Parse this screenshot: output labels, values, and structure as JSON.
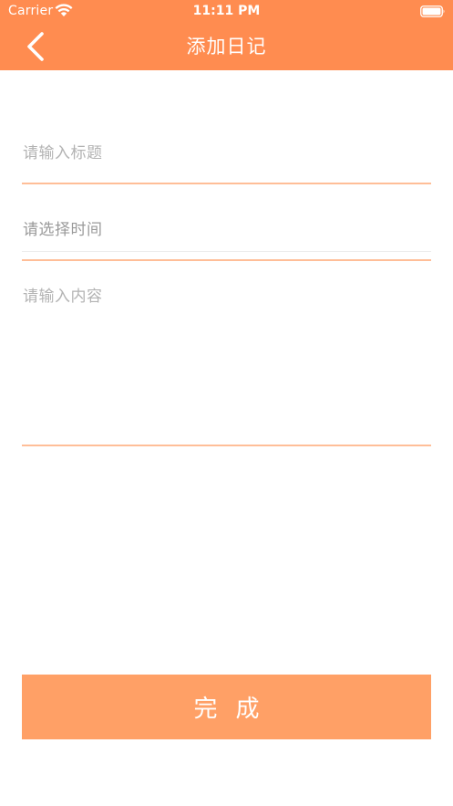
{
  "status_bar": {
    "carrier": "Carrier",
    "time": "11:11 PM"
  },
  "nav": {
    "title": "添加日记",
    "back_icon": "chevron-left-icon"
  },
  "form": {
    "title_placeholder": "请输入标题",
    "time_placeholder": "请选择时间",
    "content_placeholder": "请输入内容"
  },
  "done_button": {
    "label": "完成"
  },
  "colors": {
    "header": "#ff8c50",
    "button": "#ffa066",
    "divider": "#ffbe98",
    "placeholder": "#b3b3b3"
  }
}
